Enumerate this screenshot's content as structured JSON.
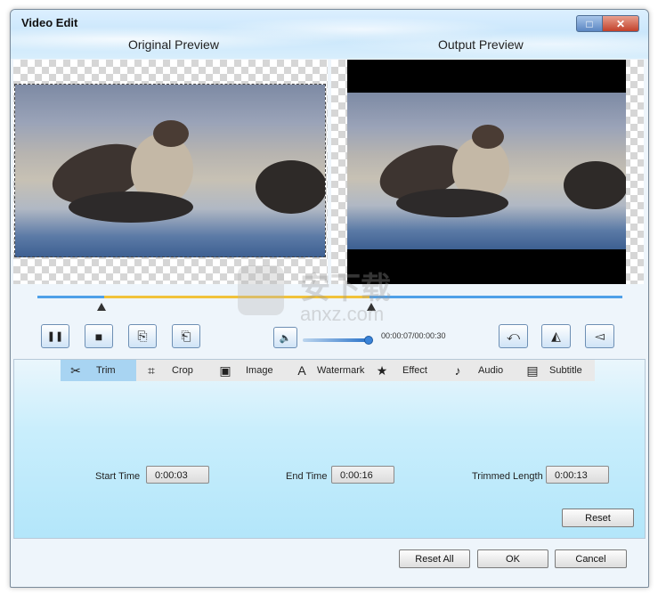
{
  "window": {
    "title": "Video Edit",
    "maximize_icon": "□",
    "close_icon": "✕"
  },
  "previews": {
    "original_label": "Original Preview",
    "output_label": "Output Preview"
  },
  "playback": {
    "pause_icon": "❚❚",
    "stop_icon": "■",
    "timecode": "00:00:07/00:00:30",
    "volume_icon": "🔈",
    "volume_level": 0.95,
    "rotate_icon": "⤺",
    "flip_horizontal_icon": "◭",
    "flip_vertical_icon": "◅"
  },
  "tabs": [
    {
      "label": "Trim",
      "icon": "✂",
      "active": true
    },
    {
      "label": "Crop",
      "icon": "⌗",
      "active": false
    },
    {
      "label": "Image",
      "icon": "▣",
      "active": false
    },
    {
      "label": "Watermark",
      "icon": "A",
      "active": false
    },
    {
      "label": "Effect",
      "icon": "★",
      "active": false
    },
    {
      "label": "Audio",
      "icon": "♪",
      "active": false
    },
    {
      "label": "Subtitle",
      "icon": "▤",
      "active": false
    }
  ],
  "trim": {
    "start_label": "Start Time",
    "start_value": "0:00:03",
    "end_label": "End Time",
    "end_value": "0:00:16",
    "length_label": "Trimmed Length",
    "length_value": "0:00:13",
    "reset_label": "Reset"
  },
  "footer": {
    "reset_all_label": "Reset All",
    "ok_label": "OK",
    "cancel_label": "Cancel"
  },
  "watermark_text": "anxz.com",
  "watermark_chars": "安下载",
  "colors": {
    "timeline": "#4fa0e8",
    "selection": "#f1c23a",
    "active_tab": "#a8d4f2"
  }
}
